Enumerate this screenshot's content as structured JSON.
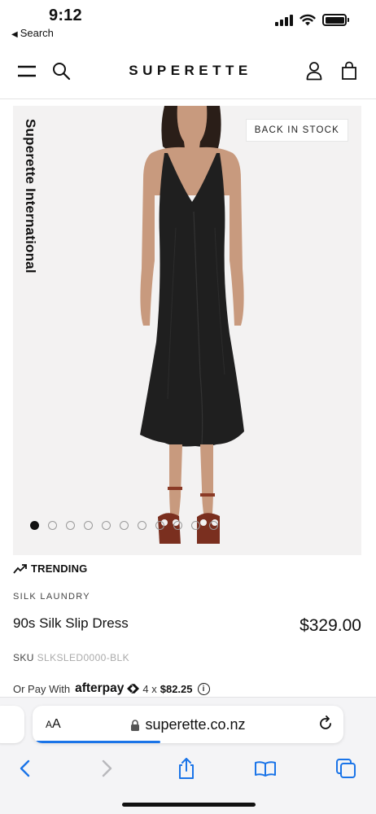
{
  "status_bar": {
    "time": "9:12",
    "back_label": "Search",
    "icons": [
      "signal-icon",
      "wifi-icon",
      "battery-icon"
    ]
  },
  "header": {
    "logo": "SUPERETTE",
    "icons": [
      "menu-icon",
      "search-icon",
      "account-icon",
      "bag-icon"
    ]
  },
  "product_image": {
    "brand_vertical": "Superette International",
    "badge": "BACK IN STOCK",
    "slide_count": 11,
    "active_slide": 1
  },
  "product": {
    "trending_label": "TRENDING",
    "brand": "SILK LAUNDRY",
    "name": "90s Silk Slip Dress",
    "price": "$329.00",
    "sku_label": "SKU",
    "sku_value": "SLKSLED0000-BLK",
    "afterpay": {
      "prefix": "Or Pay With",
      "logo_text": "afterpay",
      "installments": "4 x",
      "amount": "$82.25"
    }
  },
  "browser": {
    "text_size_label": "AA",
    "url": "superette.co.nz",
    "page_load_progress": 0.4,
    "accent_color": "#1a74e8",
    "toolbar": [
      "back-icon",
      "forward-icon",
      "share-icon",
      "bookmarks-icon",
      "tabs-icon"
    ]
  }
}
